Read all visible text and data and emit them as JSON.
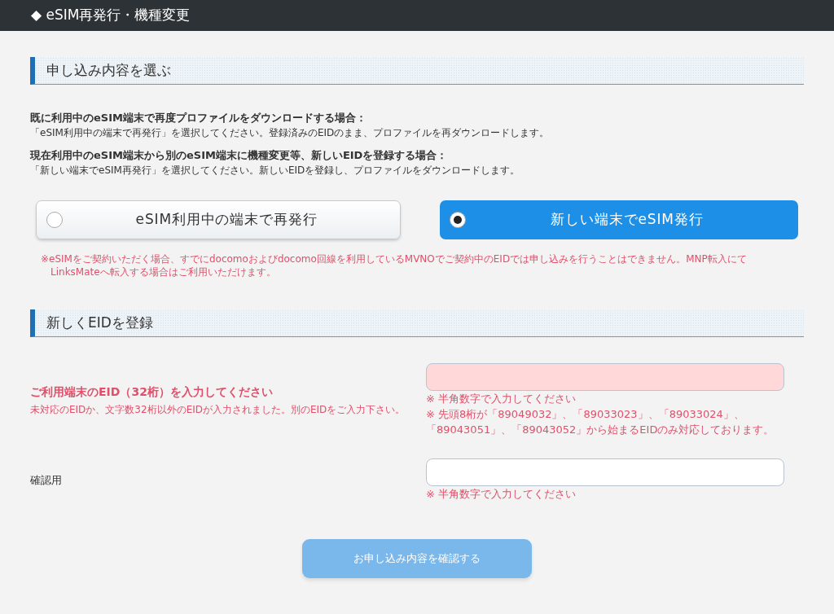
{
  "header": {
    "title": "◆ eSIM再発行・機種変更"
  },
  "sections": [
    {
      "heading": "申し込み内容を選ぶ"
    },
    {
      "heading": "新しくEIDを登録"
    }
  ],
  "instructions": [
    {
      "title": "既に利用中のeSIM端末で再度プロファイルをダウンロードする場合：",
      "body": "「eSIM利用中の端末で再発行」を選択してください。登録済みのEIDのまま、プロファイルを再ダウンロードします。"
    },
    {
      "title": "現在利用中のeSIM端末から別のeSIM端末に機種変更等、新しいEIDを登録する場合：",
      "body": "「新しい端末でeSIM再発行」を選択してください。新しいEIDを登録し、プロファイルをダウンロードします。"
    }
  ],
  "options": [
    {
      "label": "eSIM利用中の端末で再発行",
      "selected": false
    },
    {
      "label": "新しい端末でeSIM発行",
      "selected": true
    }
  ],
  "option_note": [
    "※eSIMをご契約いただく場合、すでにdocomoおよびdocomo回線を利用しているMVNOでご契約中のEIDでは申し込みを行うことはできません。MNP転入にて",
    "LinksMateへ転入する場合はご利用いただけます。"
  ],
  "fields": [
    {
      "label": "ご利用端末のEID（32桁）を入力してください",
      "error": true,
      "error_message": "未対応のEIDか、文字数32桁以外のEIDが入力されました。別のEIDをご入力下さい。",
      "notes": [
        "※ 半角数字で入力してください",
        "※ 先頭8桁が「89049032」、「89033023」、「89033024」、「89043051」、「89043052」から始まるEIDのみ対応しております。"
      ]
    },
    {
      "label": "確認用",
      "error": false,
      "notes": [
        "※ 半角数字で入力してください"
      ]
    }
  ],
  "submit": {
    "label": "お申し込み内容を確認する",
    "disabled": true
  }
}
